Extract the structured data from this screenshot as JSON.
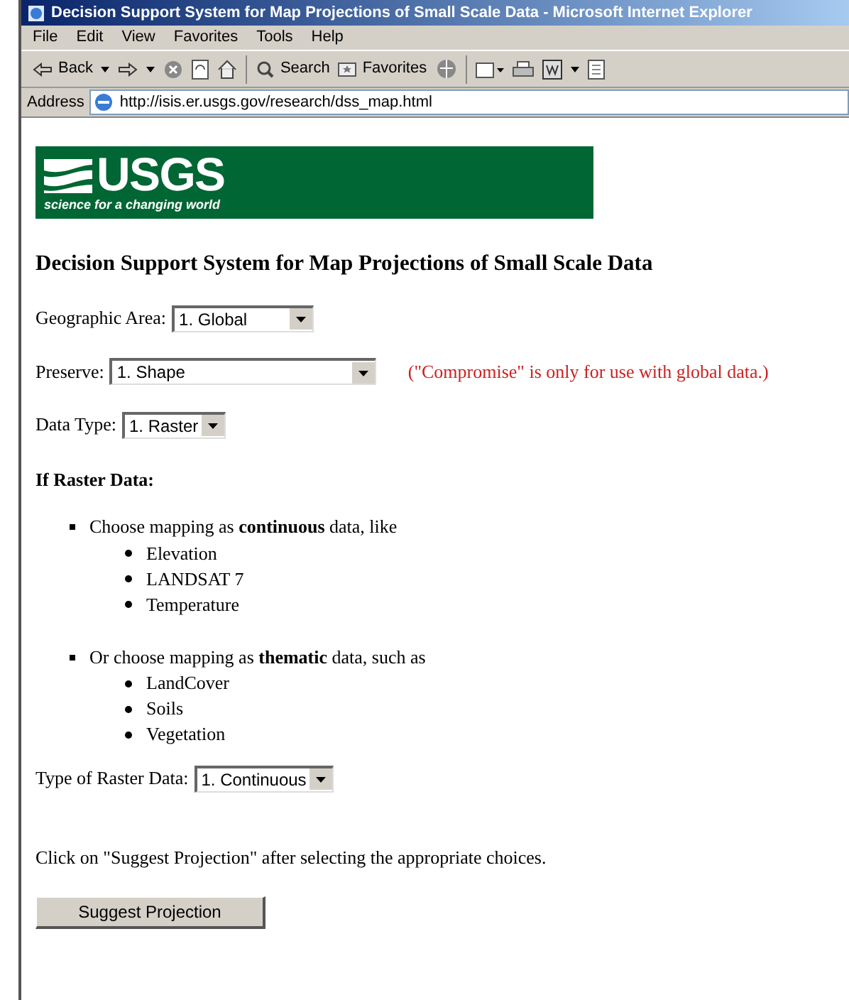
{
  "window": {
    "title": "Decision Support System for Map Projections of Small Scale Data - Microsoft Internet Explorer"
  },
  "menu": [
    "File",
    "Edit",
    "View",
    "Favorites",
    "Tools",
    "Help"
  ],
  "toolbar": {
    "back": "Back",
    "search": "Search",
    "favorites": "Favorites"
  },
  "address": {
    "label": "Address",
    "url": "http://isis.er.usgs.gov/research/dss_map.html"
  },
  "logo": {
    "name": "USGS",
    "tagline": "science for a changing world"
  },
  "heading": "Decision Support System for Map Projections of Small Scale Data",
  "fields": [
    {
      "label": "Geographic Area:",
      "value": "1. Global"
    },
    {
      "label": "Preserve:",
      "value": "1. Shape",
      "note": "(\"Compromise\" is only for use with global data.)"
    },
    {
      "label": "Data Type:",
      "value": "1. Raster"
    }
  ],
  "raster_heading": "If Raster Data:",
  "raster_options": [
    {
      "text": "Choose mapping as **continuous** data, like",
      "examples": [
        "Elevation",
        "LANDSAT 7",
        "Temperature"
      ]
    },
    {
      "text": "Or choose mapping as **thematic** data, such as",
      "examples": [
        "LandCover",
        "Soils",
        "Vegetation"
      ]
    }
  ],
  "raster_type": {
    "label": "Type of Raster Data:",
    "value": "1. Continuous"
  },
  "instruction": "Click on \"Suggest Projection\" after selecting the appropriate choices.",
  "submit": "Suggest Projection"
}
